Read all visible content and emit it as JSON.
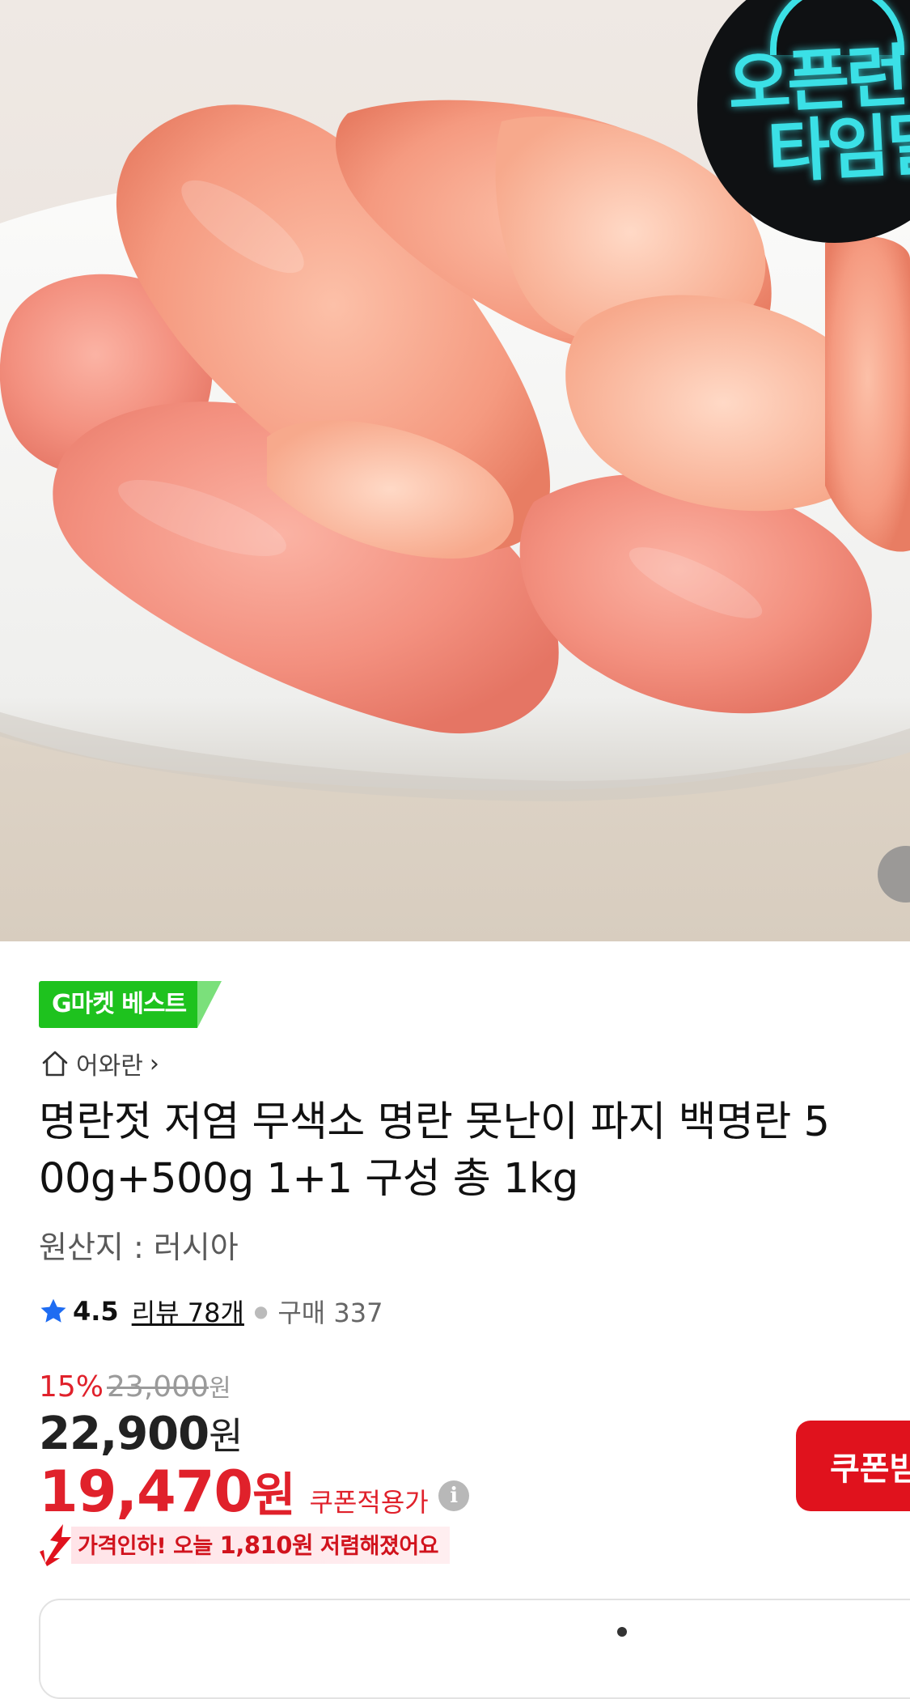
{
  "hero": {
    "promo_badge": {
      "line1": "오픈런",
      "line2": "타임딜"
    }
  },
  "badge": {
    "label": "G마켓 베스트"
  },
  "seller": {
    "name": "어와란",
    "chevron": "›"
  },
  "product": {
    "title_line1": "명란젓 저염 무색소 명란 못난이 파지 백명란 5",
    "title_line2": "00g+500g 1+1 구성 총 1kg",
    "origin": "원산지 : 러시아"
  },
  "rating": {
    "score": "4.5",
    "reviews": "리뷰 78개",
    "purchases": "구매 337"
  },
  "price": {
    "discount_percent": "15%",
    "original": "23,000",
    "original_unit": "원",
    "sale": "22,900",
    "sale_unit": "원",
    "coupon_price": "19,470",
    "coupon_unit": "원",
    "coupon_label": "쿠폰적용가",
    "info_icon": "i",
    "drop_notice_prefix": "가격인하! 오늘 ",
    "drop_amount": "1,810원",
    "drop_notice_suffix": " 저렴해졌어요"
  },
  "coupon_button": {
    "label": "쿠폰받기"
  },
  "colors": {
    "accent_red": "#e0212b",
    "best_green": "#1ec21e",
    "badge_cyan": "#3be0e6"
  }
}
